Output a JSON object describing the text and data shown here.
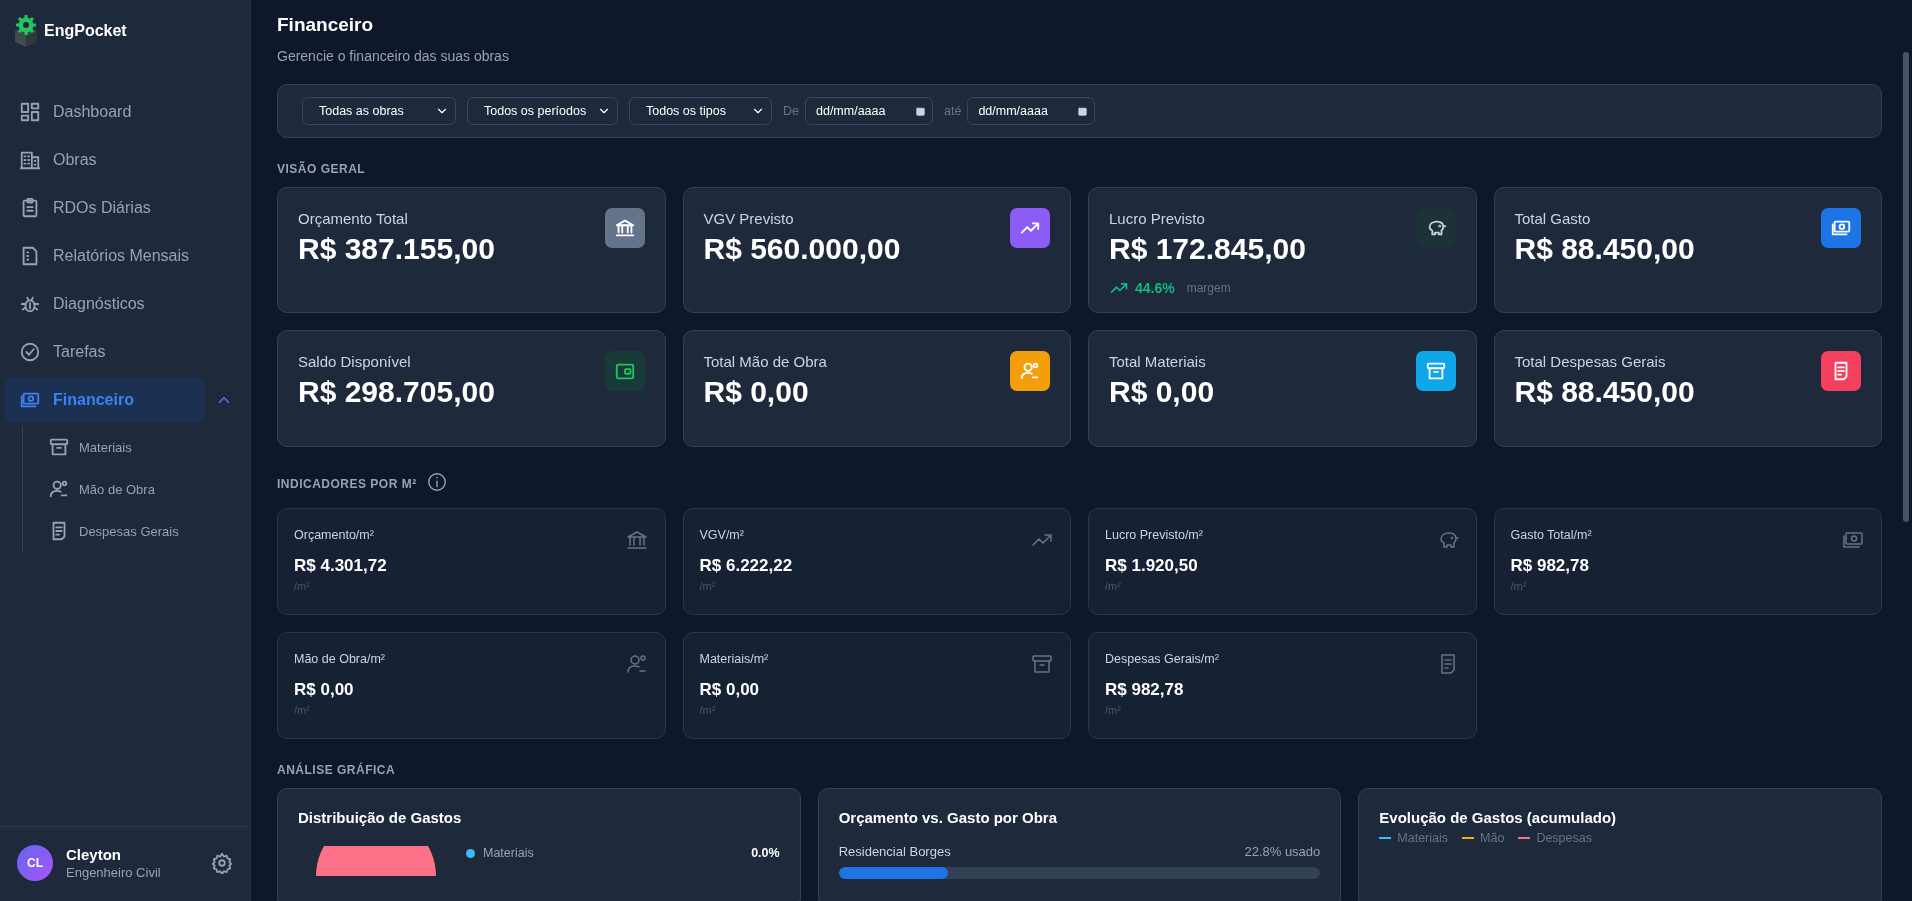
{
  "app": {
    "name": "EngPocket"
  },
  "sidebar": {
    "items": [
      {
        "label": "Dashboard",
        "selected": false
      },
      {
        "label": "Obras",
        "selected": false
      },
      {
        "label": "RDOs Diárias",
        "selected": false
      },
      {
        "label": "Relatórios Mensais",
        "selected": false
      },
      {
        "label": "Diagnósticos",
        "selected": false
      },
      {
        "label": "Tarefas",
        "selected": false
      },
      {
        "label": "Financeiro",
        "selected": true,
        "expanded": true,
        "children": [
          {
            "label": "Materiais",
            "selected": false
          },
          {
            "label": "Mão de Obra",
            "selected": false
          },
          {
            "label": "Despesas Gerais",
            "selected": false
          }
        ]
      }
    ]
  },
  "user": {
    "initials": "CL",
    "name": "Cleyton",
    "role": "Engenheiro Civil"
  },
  "header": {
    "title": "Financeiro",
    "subtitle": "Gerencie o financeiro das suas obras"
  },
  "filters": {
    "selects": [
      {
        "value": "Todas as obras"
      },
      {
        "value": "Todos os períodos"
      },
      {
        "value": "Todos os tipos"
      }
    ],
    "date_from": {
      "label": "De",
      "placeholder": "dd/mm/aaaa"
    },
    "date_to": {
      "label": "até",
      "placeholder": "dd/mm/aaaa"
    }
  },
  "overview": {
    "title": "VISÃO GERAL",
    "cards": [
      {
        "title": "Orçamento Total",
        "value": "R$ 387.155,00",
        "color": "#64748b"
      },
      {
        "title": "VGV Previsto",
        "value": "R$ 560.000,00",
        "color": "#8b5cf6"
      },
      {
        "title": "Lucro Previsto",
        "value": "R$ 172.845,00",
        "color": "#1b3338",
        "trend": {
          "value": "44.6%",
          "label": "margem"
        }
      },
      {
        "title": "Total Gasto",
        "value": "R$ 88.450,00",
        "color": "#1d74e7"
      },
      {
        "title": "Saldo Disponível",
        "value": "R$ 298.705,00",
        "color": "#183a38"
      },
      {
        "title": "Total Mão de Obra",
        "value": "R$ 0,00",
        "color": "#f59e0b"
      },
      {
        "title": "Total Materiais",
        "value": "R$ 0,00",
        "color": "#0ea5e9"
      },
      {
        "title": "Total Despesas Gerais",
        "value": "R$ 88.450,00",
        "color": "#f43f5e"
      }
    ]
  },
  "indicators": {
    "title": "INDICADORES POR M²",
    "cards": [
      {
        "title": "Orçamento/m²",
        "value": "R$ 4.301,72",
        "unit": "/m²"
      },
      {
        "title": "VGV/m²",
        "value": "R$ 6.222,22",
        "unit": "/m²"
      },
      {
        "title": "Lucro Previsto/m²",
        "value": "R$ 1.920,50",
        "unit": "/m²"
      },
      {
        "title": "Gasto Total/m²",
        "value": "R$ 982,78",
        "unit": "/m²"
      },
      {
        "title": "Mão de Obra/m²",
        "value": "R$ 0,00",
        "unit": "/m²"
      },
      {
        "title": "Materiais/m²",
        "value": "R$ 0,00",
        "unit": "/m²"
      },
      {
        "title": "Despesas Gerais/m²",
        "value": "R$ 982,78",
        "unit": "/m²"
      }
    ]
  },
  "analysis": {
    "title": "ANÁLISE GRÁFICA",
    "distribution": {
      "title": "Distribuição de Gastos",
      "legend": [
        {
          "label": "Materiais",
          "value": "0.0%",
          "color": "#38bdf8"
        }
      ]
    },
    "budget_vs_spent": {
      "title": "Orçamento vs. Gasto por Obra",
      "rows": [
        {
          "name": "Residencial Borges",
          "reading": "22.8% usado",
          "level": 0.228
        }
      ]
    },
    "evolution": {
      "title": "Evolução de Gastos (acumulado)",
      "legend": [
        {
          "label": "Materiais",
          "color": "#38bdf8"
        },
        {
          "label": "Mão",
          "color": "#eab308"
        },
        {
          "label": "Despesas",
          "color": "#fb7185"
        }
      ]
    }
  }
}
